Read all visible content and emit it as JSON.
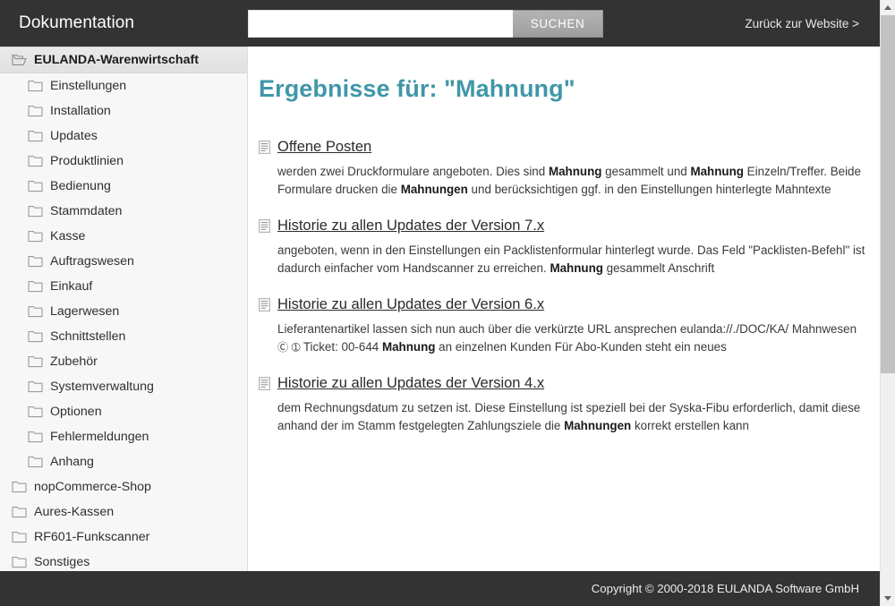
{
  "header": {
    "title": "Dokumentation",
    "search": {
      "value": "",
      "placeholder": "",
      "button_label": "SUCHEN"
    },
    "back_link": "Zurück zur Website >"
  },
  "sidebar": {
    "items": [
      {
        "label": "EULANDA-Warenwirtschaft",
        "level": 0,
        "icon": "folder-open-icon",
        "selected": true
      },
      {
        "label": "Einstellungen",
        "level": 1,
        "icon": "folder-icon",
        "selected": false
      },
      {
        "label": "Installation",
        "level": 1,
        "icon": "folder-icon",
        "selected": false
      },
      {
        "label": "Updates",
        "level": 1,
        "icon": "folder-icon",
        "selected": false
      },
      {
        "label": "Produktlinien",
        "level": 1,
        "icon": "folder-icon",
        "selected": false
      },
      {
        "label": "Bedienung",
        "level": 1,
        "icon": "folder-icon",
        "selected": false
      },
      {
        "label": "Stammdaten",
        "level": 1,
        "icon": "folder-icon",
        "selected": false
      },
      {
        "label": "Kasse",
        "level": 1,
        "icon": "folder-icon",
        "selected": false
      },
      {
        "label": "Auftragswesen",
        "level": 1,
        "icon": "folder-icon",
        "selected": false
      },
      {
        "label": "Einkauf",
        "level": 1,
        "icon": "folder-icon",
        "selected": false
      },
      {
        "label": "Lagerwesen",
        "level": 1,
        "icon": "folder-icon",
        "selected": false
      },
      {
        "label": "Schnittstellen",
        "level": 1,
        "icon": "folder-icon",
        "selected": false
      },
      {
        "label": "Zubehör",
        "level": 1,
        "icon": "folder-icon",
        "selected": false
      },
      {
        "label": "Systemverwaltung",
        "level": 1,
        "icon": "folder-icon",
        "selected": false
      },
      {
        "label": "Optionen",
        "level": 1,
        "icon": "folder-icon",
        "selected": false
      },
      {
        "label": "Fehlermeldungen",
        "level": 1,
        "icon": "folder-icon",
        "selected": false
      },
      {
        "label": "Anhang",
        "level": 1,
        "icon": "folder-icon",
        "selected": false
      },
      {
        "label": "nopCommerce-Shop",
        "level": 0,
        "icon": "folder-icon",
        "selected": false
      },
      {
        "label": "Aures-Kassen",
        "level": 0,
        "icon": "folder-icon",
        "selected": false
      },
      {
        "label": "RF601-Funkscanner",
        "level": 0,
        "icon": "folder-icon",
        "selected": false
      },
      {
        "label": "Sonstiges",
        "level": 0,
        "icon": "folder-icon",
        "selected": false
      }
    ]
  },
  "main": {
    "results_title": "Ergebnisse für: \"Mahnung\"",
    "results": [
      {
        "title": "Offene Posten",
        "snippet_html": "werden zwei Druckformulare angeboten. Dies sind <b>Mahnung</b> gesammelt und <b>Mahnung</b> Einzeln/Treffer. Beide Formulare drucken die <b>Mahnungen</b> und berücksichtigen ggf. in den Einstellungen hinterlegte Mahntexte"
      },
      {
        "title": "Historie zu allen Updates der Version 7.x",
        "snippet_html": "angeboten, wenn in den Einstellungen ein Packlistenformular hinterlegt wurde. Das Feld \"Packlisten-Befehl\" ist dadurch einfacher vom Handscanner zu erreichen. <b>Mahnung</b> gesammelt Anschrift"
      },
      {
        "title": "Historie zu allen Updates der Version 6.x",
        "snippet_html": "Lieferantenartikel lassen sich nun auch über die verkürzte URL ansprechen eulanda://./DOC/KA/ Mahnwesen <span class=\"glyph-c\">&#9400;</span> <span class=\"glyph-q\">&#10112;</span> Ticket: 00-644 <b>Mahnung</b> an einzelnen Kunden Für Abo-Kunden steht ein neues"
      },
      {
        "title": "Historie zu allen Updates der Version 4.x",
        "snippet_html": "dem Rechnungsdatum zu setzen ist. Diese Einstellung ist speziell bei der Syska-Fibu erforderlich, damit diese anhand der im Stamm festgelegten Zahlungsziele die <b>Mahnungen</b> korrekt erstellen kann"
      }
    ]
  },
  "footer": {
    "copyright": "Copyright © 2000-2018 EULANDA Software GmbH"
  },
  "colors": {
    "header_bg": "#333333",
    "sidebar_bg": "#f7f7f7",
    "accent_teal": "#3f97a8",
    "search_button": "#a8a8a8"
  }
}
